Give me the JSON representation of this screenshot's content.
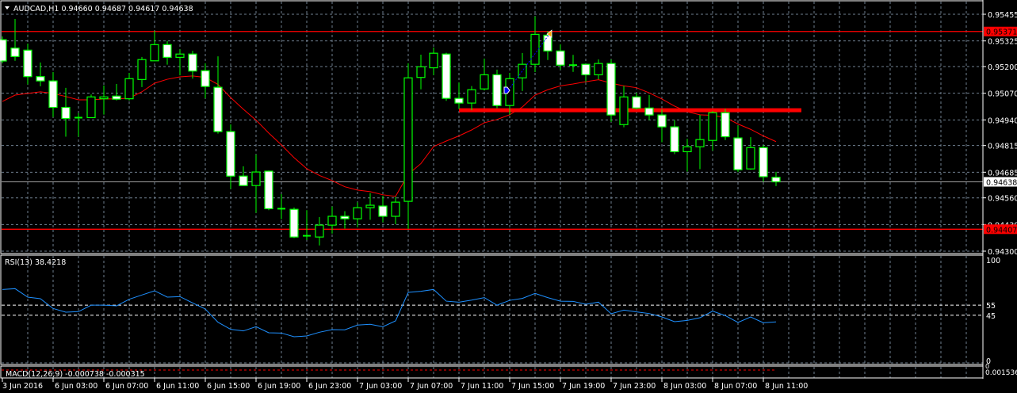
{
  "header": {
    "menu_icon": "triangle-down-icon",
    "title": "AUDCAD,H1  0.94660 0.94687 0.94617 0.94638"
  },
  "colors": {
    "background": "#000000",
    "candle_outline": "#00ff00",
    "bear_fill": "#ffffff",
    "bull_fill": "#000000",
    "ma_line": "#ff0000",
    "rsi_line": "#1e90ff",
    "level_line": "#ff0000",
    "grid": "#708090"
  },
  "chart_data": [
    {
      "type": "candlestick",
      "symbol": "AUDCAD",
      "timeframe": "H1",
      "ylim": [
        0.943,
        0.95455
      ],
      "grid": true,
      "price_ticks": [
        "0.95455",
        "0.95325",
        "0.95200",
        "0.95070",
        "0.94940",
        "0.94815",
        "0.94685",
        "0.94560",
        "0.94430",
        "0.94300"
      ],
      "x_ticks": [
        {
          "label": "3 Jun 2016",
          "index": 0
        },
        {
          "label": "6 Jun 03:00",
          "index": 4
        },
        {
          "label": "6 Jun 07:00",
          "index": 8
        },
        {
          "label": "6 Jun 11:00",
          "index": 12
        },
        {
          "label": "6 Jun 15:00",
          "index": 16
        },
        {
          "label": "6 Jun 19:00",
          "index": 20
        },
        {
          "label": "6 Jun 23:00",
          "index": 24
        },
        {
          "label": "7 Jun 03:00",
          "index": 28
        },
        {
          "label": "7 Jun 07:00",
          "index": 32
        },
        {
          "label": "7 Jun 11:00",
          "index": 36
        },
        {
          "label": "7 Jun 15:00",
          "index": 40
        },
        {
          "label": "7 Jun 19:00",
          "index": 44
        },
        {
          "label": "7 Jun 23:00",
          "index": 48
        },
        {
          "label": "8 Jun 03:00",
          "index": 52
        },
        {
          "label": "8 Jun 07:00",
          "index": 56
        },
        {
          "label": "8 Jun 11:00",
          "index": 60
        }
      ],
      "ohlc": [
        [
          0.95331,
          0.95347,
          0.95216,
          0.95227
        ],
        [
          0.9529,
          0.95432,
          0.95228,
          0.95249
        ],
        [
          0.9528,
          0.95312,
          0.95113,
          0.95151
        ],
        [
          0.95151,
          0.9522,
          0.95104,
          0.9513
        ],
        [
          0.9513,
          0.95173,
          0.94954,
          0.95001
        ],
        [
          0.95001,
          0.95096,
          0.94858,
          0.94947
        ],
        [
          0.94951,
          0.94973,
          0.94858,
          0.94949
        ],
        [
          0.94951,
          0.95064,
          0.94951,
          0.95052
        ],
        [
          0.95043,
          0.95108,
          0.94966,
          0.95052
        ],
        [
          0.95056,
          0.95115,
          0.95035,
          0.95041
        ],
        [
          0.95043,
          0.95169,
          0.95035,
          0.95141
        ],
        [
          0.95137,
          0.95247,
          0.951,
          0.95234
        ],
        [
          0.95228,
          0.95374,
          0.95228,
          0.95307
        ],
        [
          0.95307,
          0.95325,
          0.95209,
          0.95245
        ],
        [
          0.95245,
          0.95284,
          0.95157,
          0.95261
        ],
        [
          0.95261,
          0.95277,
          0.95141,
          0.95178
        ],
        [
          0.9518,
          0.95216,
          0.95045,
          0.95103
        ],
        [
          0.95099,
          0.9525,
          0.94873,
          0.94883
        ],
        [
          0.94883,
          0.94918,
          0.94603,
          0.94666
        ],
        [
          0.94666,
          0.94714,
          0.9462,
          0.9462
        ],
        [
          0.9462,
          0.94771,
          0.94487,
          0.94686
        ],
        [
          0.9469,
          0.94693,
          0.945,
          0.94507
        ],
        [
          0.94507,
          0.94578,
          0.94456,
          0.94505
        ],
        [
          0.94504,
          0.94513,
          0.94364,
          0.94369
        ],
        [
          0.94375,
          0.945,
          0.94354,
          0.94373
        ],
        [
          0.94369,
          0.94466,
          0.94328,
          0.94427
        ],
        [
          0.94427,
          0.94518,
          0.94386,
          0.9447
        ],
        [
          0.9447,
          0.94495,
          0.9441,
          0.94458
        ],
        [
          0.94458,
          0.94538,
          0.94418,
          0.94512
        ],
        [
          0.94512,
          0.94583,
          0.94453,
          0.94524
        ],
        [
          0.9452,
          0.9457,
          0.94441,
          0.9447
        ],
        [
          0.9447,
          0.94565,
          0.94431,
          0.94539
        ],
        [
          0.94543,
          0.95216,
          0.94409,
          0.95145
        ],
        [
          0.95147,
          0.95258,
          0.95089,
          0.95199
        ],
        [
          0.95194,
          0.95293,
          0.95158,
          0.95265
        ],
        [
          0.95261,
          0.95267,
          0.95033,
          0.95045
        ],
        [
          0.95045,
          0.95122,
          0.94993,
          0.95022
        ],
        [
          0.95022,
          0.95105,
          0.94987,
          0.95087
        ],
        [
          0.95091,
          0.95239,
          0.95083,
          0.9516
        ],
        [
          0.9516,
          0.95185,
          0.94997,
          0.9501
        ],
        [
          0.9501,
          0.95169,
          0.94965,
          0.95141
        ],
        [
          0.95145,
          0.95266,
          0.95081,
          0.95211
        ],
        [
          0.95211,
          0.95445,
          0.95173,
          0.95357
        ],
        [
          0.95353,
          0.95373,
          0.95232,
          0.95276
        ],
        [
          0.95276,
          0.95308,
          0.95184,
          0.95207
        ],
        [
          0.95207,
          0.95257,
          0.95174,
          0.95207
        ],
        [
          0.95211,
          0.95212,
          0.95126,
          0.9516
        ],
        [
          0.9516,
          0.95235,
          0.95138,
          0.95215
        ],
        [
          0.95215,
          0.95235,
          0.9493,
          0.94964
        ],
        [
          0.94917,
          0.95106,
          0.94904,
          0.95052
        ],
        [
          0.95052,
          0.95072,
          0.94991,
          0.94998
        ],
        [
          0.94998,
          0.95061,
          0.94939,
          0.94964
        ],
        [
          0.94964,
          0.94991,
          0.94831,
          0.94906
        ],
        [
          0.94906,
          0.94939,
          0.94773,
          0.94785
        ],
        [
          0.94785,
          0.94848,
          0.94688,
          0.94809
        ],
        [
          0.94809,
          0.94964,
          0.947,
          0.94844
        ],
        [
          0.9484,
          0.94983,
          0.9479,
          0.94975
        ],
        [
          0.94975,
          0.94994,
          0.94842,
          0.94858
        ],
        [
          0.94852,
          0.94912,
          0.94686,
          0.94697
        ],
        [
          0.94701,
          0.94856,
          0.94697,
          0.94805
        ],
        [
          0.94805,
          0.94817,
          0.94639,
          0.94663
        ],
        [
          0.9466,
          0.94687,
          0.94617,
          0.94638
        ]
      ],
      "moving_average": [
        0.9503,
        0.95061,
        0.95069,
        0.95077,
        0.95069,
        0.95054,
        0.95038,
        0.95038,
        0.95042,
        0.95042,
        0.95046,
        0.95077,
        0.95119,
        0.95138,
        0.9515,
        0.95154,
        0.95147,
        0.95113,
        0.95049,
        0.94992,
        0.94939,
        0.94876,
        0.94818,
        0.94756,
        0.94702,
        0.94669,
        0.94644,
        0.94614,
        0.94598,
        0.9459,
        0.94575,
        0.94567,
        0.94675,
        0.94727,
        0.9481,
        0.94837,
        0.94862,
        0.94891,
        0.94926,
        0.94942,
        0.94965,
        0.95003,
        0.95061,
        0.95087,
        0.95106,
        0.95115,
        0.95126,
        0.95136,
        0.95119,
        0.95106,
        0.95097,
        0.95072,
        0.95042,
        0.95007,
        0.9498,
        0.94965,
        0.94962,
        0.94952,
        0.9492,
        0.94894,
        0.94862,
        0.94834
      ],
      "horizontal_lines": [
        {
          "price": 0.95371,
          "label": "0.95371",
          "color": "#ff0000"
        },
        {
          "price": 0.94407,
          "label": "0.94407",
          "color": "#ff0000"
        }
      ],
      "current_price": {
        "price": 0.94638,
        "label": "0.94638"
      },
      "zone_line": {
        "price": 0.94987,
        "start_index": 36,
        "end_index": 63,
        "color": "#ff0000"
      },
      "trade_markers": [
        {
          "type": "buy-arrow",
          "index": 40,
          "price": 0.95084,
          "color": "#0000ff"
        },
        {
          "type": "close-arrow",
          "index": 43,
          "price": 0.95358,
          "color": "#ffa500"
        }
      ]
    },
    {
      "type": "line",
      "label": "RSI(13) 38.4218",
      "ylim": [
        0,
        100
      ],
      "levels": [
        55,
        45
      ],
      "axis_ticks": [
        "100",
        "55",
        "45",
        "0"
      ],
      "values": [
        70.6,
        71.4,
        63,
        61.4,
        51.7,
        48,
        48.6,
        55,
        55,
        54.3,
        60.9,
        65.1,
        69.3,
        63,
        63.5,
        57.2,
        51.2,
        38,
        31,
        29.4,
        33.6,
        27.6,
        27.3,
        23.6,
        24.4,
        28.1,
        30.7,
        30.5,
        35.2,
        36,
        33.6,
        39.4,
        67.7,
        68.8,
        70.6,
        59,
        58,
        60,
        62.5,
        55,
        59.8,
        61.7,
        66.7,
        62.5,
        59,
        58.8,
        55.9,
        58,
        46.5,
        50.1,
        48.3,
        46.7,
        43.3,
        38.6,
        39.9,
        42.5,
        49.1,
        44.6,
        37.8,
        43.3,
        37.5,
        38.4
      ]
    },
    {
      "type": "bar",
      "label": "MACD(12,26,9) -0.000738 -0.000315",
      "axis_ticks": [
        "0.001536",
        "0"
      ]
    }
  ]
}
